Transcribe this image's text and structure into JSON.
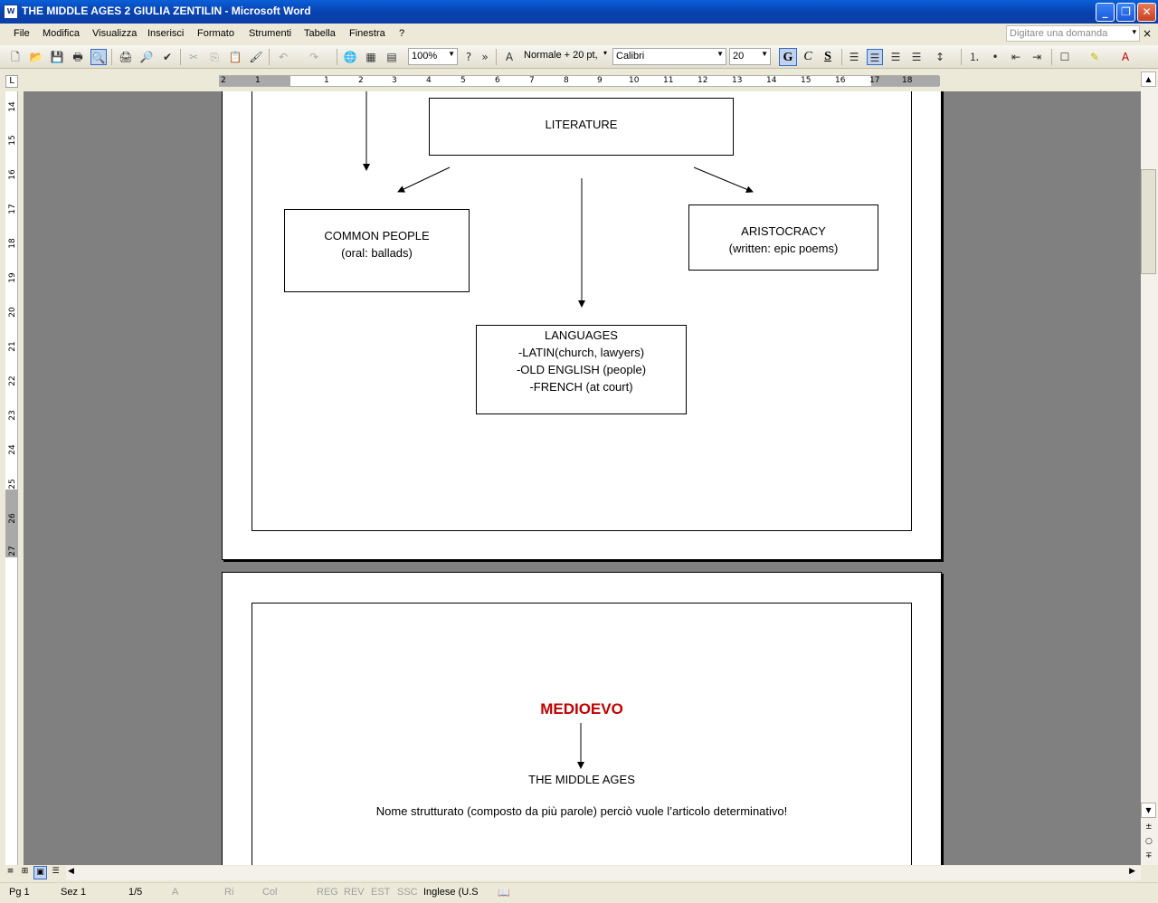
{
  "window": {
    "title": "THE MIDDLE AGES 2 GIULIA ZENTILIN - Microsoft Word",
    "icon_label": "W",
    "buttons": {
      "minimize": "_",
      "restore": "❐",
      "close": "✕"
    }
  },
  "menu": {
    "items": [
      "File",
      "Modifica",
      "Visualizza",
      "Inserisci",
      "Formato",
      "Strumenti",
      "Tabella",
      "Finestra",
      "?"
    ],
    "help_placeholder": "Digitare una domanda"
  },
  "toolbar": {
    "zoom": "100%",
    "style": "Normale + 20 pt,",
    "font": "Calibri",
    "size": "20",
    "bold_label": "G",
    "italic_label": "C",
    "underline_label": "S"
  },
  "ruler": {
    "h_numbers": [
      "2",
      "1",
      "1",
      "2",
      "3",
      "4",
      "5",
      "6",
      "7",
      "8",
      "9",
      "10",
      "11",
      "12",
      "13",
      "14",
      "15",
      "16",
      "17",
      "18"
    ],
    "v_numbers": [
      "14",
      "15",
      "16",
      "17",
      "18",
      "19",
      "20",
      "21",
      "22",
      "23",
      "24",
      "25",
      "26",
      "27"
    ]
  },
  "document": {
    "page1": {
      "literature": "LITERATURE",
      "common_people_title": "COMMON PEOPLE",
      "common_people_sub": "(oral: ballads)",
      "aristocracy_title": "ARISTOCRACY",
      "aristocracy_sub": "(written: epic poems)",
      "languages_title": "LANGUAGES",
      "languages_items": [
        "-LATIN(church, lawyers)",
        "-OLD ENGLISH (people)",
        "-FRENCH (at court)"
      ]
    },
    "page2": {
      "heading": "MEDIOEVO",
      "heading_color": "#c00000",
      "subheading": "THE MIDDLE AGES",
      "note": "Nome strutturato (composto da più parole) perciò vuole l’articolo determinativo!"
    }
  },
  "status": {
    "page": "Pg 1",
    "section": "Sez 1",
    "pages": "1/5",
    "at": "A",
    "line": "Ri",
    "col": "Col",
    "rec": "REG",
    "rev": "REV",
    "ext": "EST",
    "ovr": "SSC",
    "language": "Inglese (U.S"
  },
  "colors": {
    "titlebar": "#0842b0",
    "chrome": "#ece9d8",
    "workspace": "#808080"
  }
}
